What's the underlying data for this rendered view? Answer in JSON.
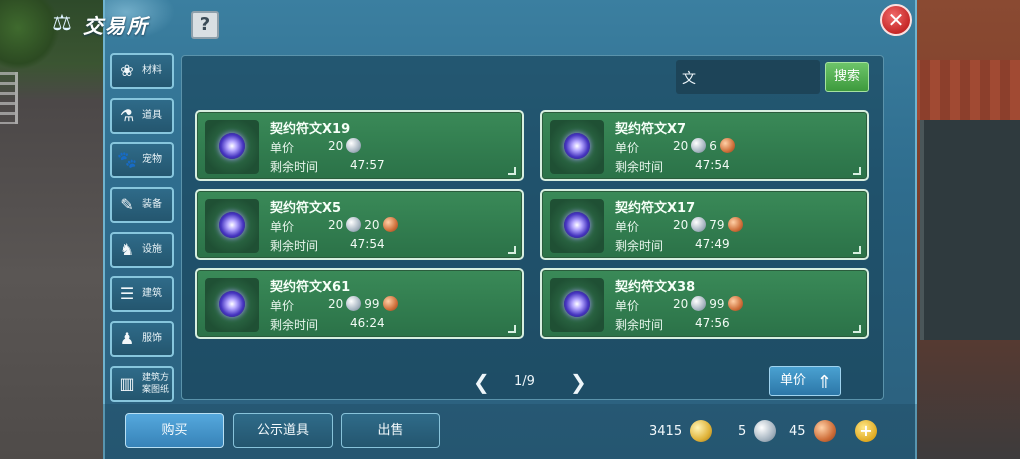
{
  "header": {
    "title": "交易所",
    "help_label": "?",
    "close_label": "✕"
  },
  "sidebar": {
    "items": [
      {
        "label": "材料",
        "icon": "materials-icon",
        "glyph": "❀"
      },
      {
        "label": "道具",
        "icon": "props-icon",
        "glyph": "⚗"
      },
      {
        "label": "宠物",
        "icon": "pet-paw-icon",
        "glyph": "🐾"
      },
      {
        "label": "装备",
        "icon": "equipment-icon",
        "glyph": "✎"
      },
      {
        "label": "设施",
        "icon": "facility-icon",
        "glyph": "♞"
      },
      {
        "label": "建筑",
        "icon": "building-icon",
        "glyph": "☰"
      },
      {
        "label": "服饰",
        "icon": "clothing-icon",
        "glyph": "♟"
      },
      {
        "label": "建筑方\n案图纸",
        "icon": "blueprint-icon",
        "glyph": "▥"
      }
    ]
  },
  "search": {
    "value": "文",
    "button_label": "搜索"
  },
  "listings": [
    {
      "name": "契约符文X19",
      "price_label": "单价",
      "silver": "20",
      "copper": "",
      "time_label": "剩余时间",
      "time": "47:57"
    },
    {
      "name": "契约符文X7",
      "price_label": "单价",
      "silver": "20",
      "copper": "6",
      "time_label": "剩余时间",
      "time": "47:54"
    },
    {
      "name": "契约符文X5",
      "price_label": "单价",
      "silver": "20",
      "copper": "20",
      "time_label": "剩余时间",
      "time": "47:54"
    },
    {
      "name": "契约符文X17",
      "price_label": "单价",
      "silver": "20",
      "copper": "79",
      "time_label": "剩余时间",
      "time": "47:49"
    },
    {
      "name": "契约符文X61",
      "price_label": "单价",
      "silver": "20",
      "copper": "99",
      "time_label": "剩余时间",
      "time": "46:24"
    },
    {
      "name": "契约符文X38",
      "price_label": "单价",
      "silver": "20",
      "copper": "99",
      "time_label": "剩余时间",
      "time": "47:56"
    }
  ],
  "pagination": {
    "label": "1/9",
    "prev": "❮",
    "next": "❯"
  },
  "sort": {
    "label": "单价",
    "arrow": "⇑"
  },
  "tabs": {
    "buy": "购买",
    "public": "公示道具",
    "sell": "出售"
  },
  "currency": {
    "gold": "3415",
    "silver": "5",
    "copper": "45",
    "add_label": "+"
  },
  "colors": {
    "panel": "#2f6d8e",
    "card": "#2b7248",
    "close": "#c62828",
    "active_tab": "#3783b8"
  }
}
